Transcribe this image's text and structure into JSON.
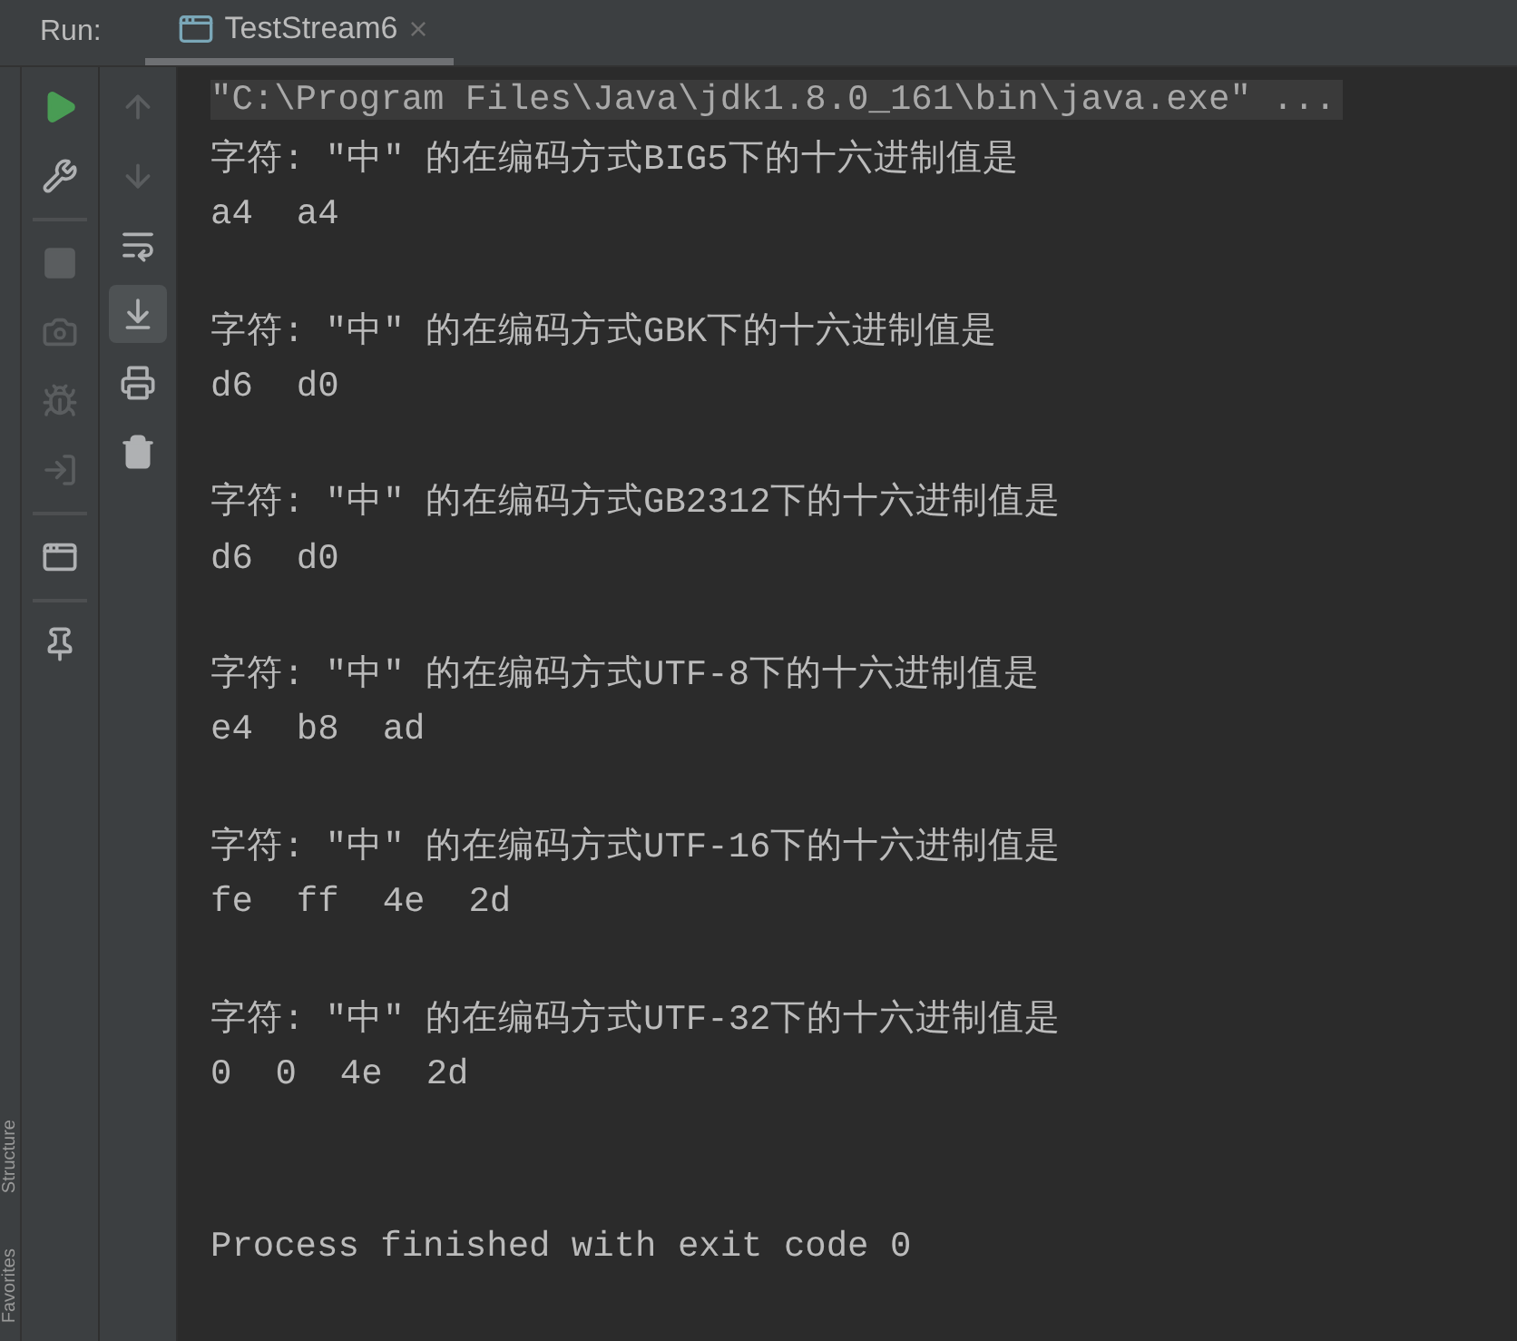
{
  "header": {
    "label": "Run:",
    "tab": {
      "title": "TestStream6",
      "close": "×",
      "selected": true
    }
  },
  "side_labels": [
    "Structure",
    "Favorites"
  ],
  "toolbar_left": [
    {
      "kind": "run",
      "disabled": false
    },
    {
      "kind": "wrench",
      "disabled": false
    },
    {
      "kind": "sep"
    },
    {
      "kind": "stop",
      "disabled": true
    },
    {
      "kind": "camera",
      "disabled": true
    },
    {
      "kind": "bug",
      "disabled": true
    },
    {
      "kind": "login",
      "disabled": true
    },
    {
      "kind": "sep"
    },
    {
      "kind": "layout",
      "disabled": false
    },
    {
      "kind": "sep"
    },
    {
      "kind": "pin",
      "disabled": false
    }
  ],
  "toolbar_right": [
    {
      "kind": "up",
      "disabled": true,
      "selected": false
    },
    {
      "kind": "down",
      "disabled": true,
      "selected": false
    },
    {
      "kind": "wrap",
      "disabled": false,
      "selected": false
    },
    {
      "kind": "scroll",
      "disabled": false,
      "selected": true
    },
    {
      "kind": "print",
      "disabled": false,
      "selected": false
    },
    {
      "kind": "trash",
      "disabled": false,
      "selected": false
    }
  ],
  "console": {
    "command": "\"C:\\Program Files\\Java\\jdk1.8.0_161\\bin\\java.exe\" ...",
    "groups": [
      {
        "header": "字符: \"中\" 的在编码方式BIG5下的十六进制值是",
        "values": [
          "a4",
          "a4"
        ]
      },
      {
        "header": "字符: \"中\" 的在编码方式GBK下的十六进制值是",
        "values": [
          "d6",
          "d0"
        ]
      },
      {
        "header": "字符: \"中\" 的在编码方式GB2312下的十六进制值是",
        "values": [
          "d6",
          "d0"
        ]
      },
      {
        "header": "字符: \"中\" 的在编码方式UTF-8下的十六进制值是",
        "values": [
          "e4",
          "b8",
          "ad"
        ]
      },
      {
        "header": "字符: \"中\" 的在编码方式UTF-16下的十六进制值是",
        "values": [
          "fe",
          "ff",
          "4e",
          "2d"
        ]
      },
      {
        "header": "字符: \"中\" 的在编码方式UTF-32下的十六进制值是",
        "values": [
          "0",
          "0",
          "4e",
          "2d"
        ]
      }
    ],
    "finish": "Process finished with exit code 0"
  }
}
